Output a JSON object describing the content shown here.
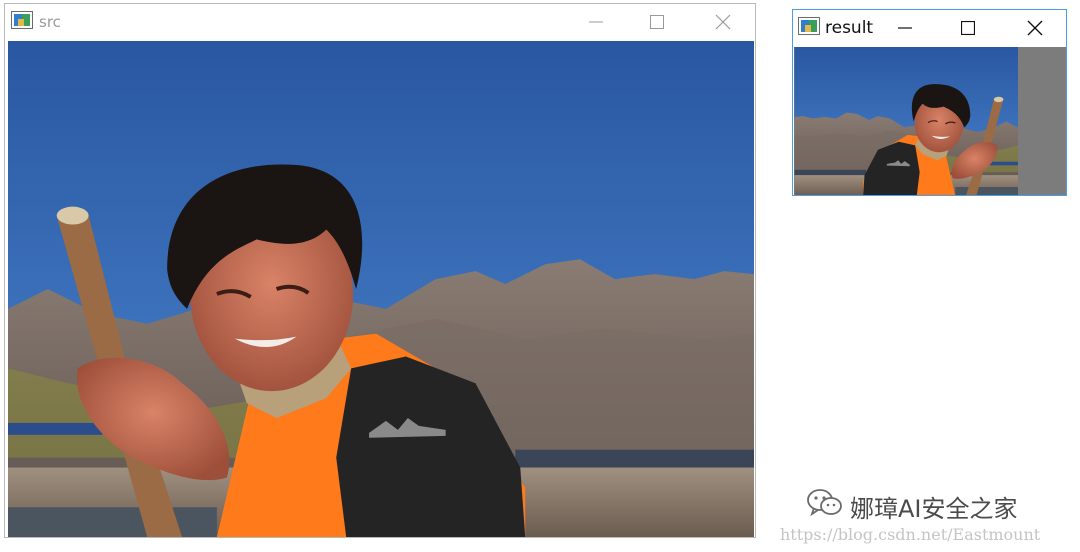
{
  "windows": {
    "src": {
      "title": "src"
    },
    "result": {
      "title": "result"
    }
  },
  "icons": {
    "app": "image-viewer-icon",
    "minimize": "minimize-icon",
    "maximize": "maximize-icon",
    "close": "close-icon",
    "wechat": "wechat-icon"
  },
  "colors": {
    "sky": "#2f5fa5",
    "life_vest": "#ff7a1a",
    "result_padding": "#7c7c7c",
    "active_border": "#4a9ee6"
  },
  "footer": {
    "watermark": "娜璋AI安全之家",
    "url": "https://blog.csdn.net/Eastmount"
  }
}
